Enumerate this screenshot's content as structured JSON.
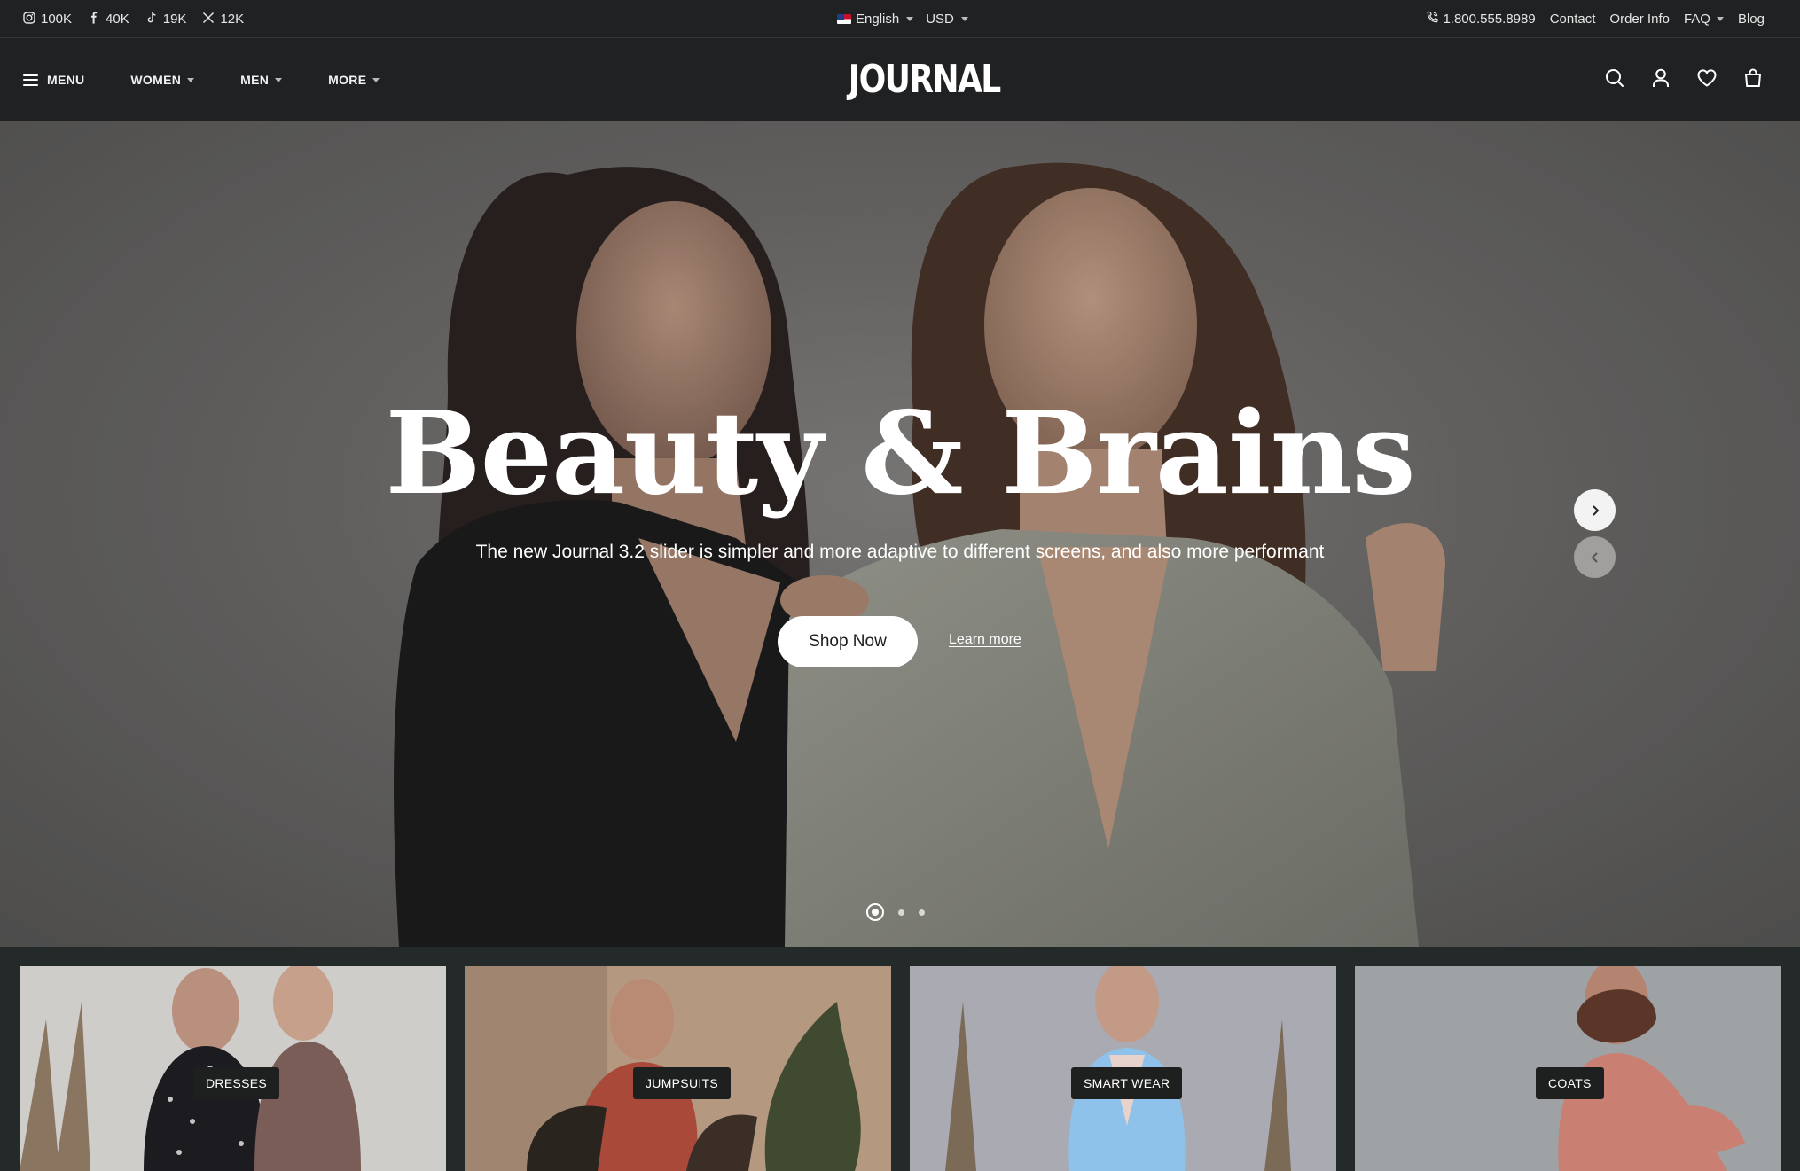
{
  "social": [
    {
      "icon": "instagram-icon",
      "count": "100K"
    },
    {
      "icon": "facebook-icon",
      "count": "40K"
    },
    {
      "icon": "tiktok-icon",
      "count": "19K"
    },
    {
      "icon": "x-icon",
      "count": "12K"
    }
  ],
  "locale": {
    "language": "English",
    "currency": "USD"
  },
  "toplinks": {
    "phone": "1.800.555.8989",
    "contact": "Contact",
    "order_info": "Order Info",
    "faq": "FAQ",
    "blog": "Blog"
  },
  "nav": {
    "menu": "MENU",
    "women": "WOMEN",
    "men": "MEN",
    "more": "MORE"
  },
  "logo": "JOURNAL",
  "hero": {
    "title": "Beauty & Brains",
    "subtitle": "The new Journal 3.2 slider is simpler and more adaptive to different screens, and also more performant",
    "cta": "Shop Now",
    "secondary": "Learn more",
    "slides_total": 3,
    "active_slide": 1
  },
  "categories": [
    {
      "label": "DRESSES"
    },
    {
      "label": "JUMPSUITS"
    },
    {
      "label": "SMART WEAR"
    },
    {
      "label": "COATS"
    }
  ],
  "colors": {
    "header_bg": "#1f2123",
    "category_bg": "#242a2a",
    "label_bg": "#1e2020"
  }
}
